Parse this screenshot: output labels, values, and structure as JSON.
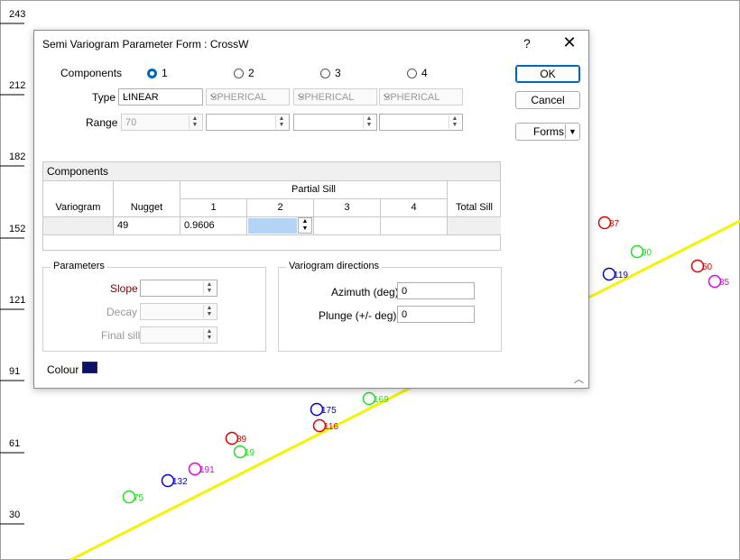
{
  "plot": {
    "y_ticks": [
      "243",
      "212",
      "182",
      "152",
      "121",
      "91",
      "61",
      "30"
    ],
    "samples": [
      {
        "label": "87",
        "color": "#e00000"
      },
      {
        "label": "90",
        "color": "#1fe01f"
      },
      {
        "label": "119",
        "color": "#0000d0"
      },
      {
        "label": "50",
        "color": "#e00000"
      },
      {
        "label": "85",
        "color": "#e000e0"
      },
      {
        "label": "175",
        "color": "#0000d0"
      },
      {
        "label": "169",
        "color": "#1fe01f"
      },
      {
        "label": "116",
        "color": "#e00000"
      },
      {
        "label": "89",
        "color": "#e00000"
      },
      {
        "label": "19",
        "color": "#1fe01f"
      },
      {
        "label": "191",
        "color": "#e000e0"
      },
      {
        "label": "132",
        "color": "#0000d0"
      },
      {
        "label": "75",
        "color": "#1fe01f"
      }
    ],
    "trend_line_color": "#f4f400"
  },
  "dialog": {
    "title": "Semi Variogram Parameter Form : CrossW",
    "help": "?",
    "close": "✕",
    "components_label": "Components",
    "radios": [
      "1",
      "2",
      "3",
      "4"
    ],
    "selected_component": "1",
    "type_label": "Type",
    "types": [
      "LINEAR",
      "SPHERICAL",
      "SPHERICAL",
      "SPHERICAL"
    ],
    "range_label": "Range",
    "ranges": [
      "70",
      "",
      "",
      ""
    ],
    "ok": "OK",
    "cancel": "Cancel",
    "forms": "Forms",
    "grid": {
      "title": "Components",
      "partial_sill": "Partial Sill",
      "headers": [
        "Variogram",
        "Nugget",
        "1",
        "2",
        "3",
        "4",
        "Total Sill"
      ],
      "row": [
        "",
        "49",
        "0.9606",
        "",
        "",
        "",
        ""
      ]
    },
    "parameters": {
      "title": "Parameters",
      "slope": "Slope",
      "decay": "Decay",
      "final_sill": "Final sill"
    },
    "directions": {
      "title": "Variogram directions",
      "azimuth_label": "Azimuth (deg)",
      "azimuth": "0",
      "plunge_label": "Plunge (+/- deg)",
      "plunge": "0"
    },
    "colour_label": "Colour",
    "colour_value": "#0d1266"
  }
}
